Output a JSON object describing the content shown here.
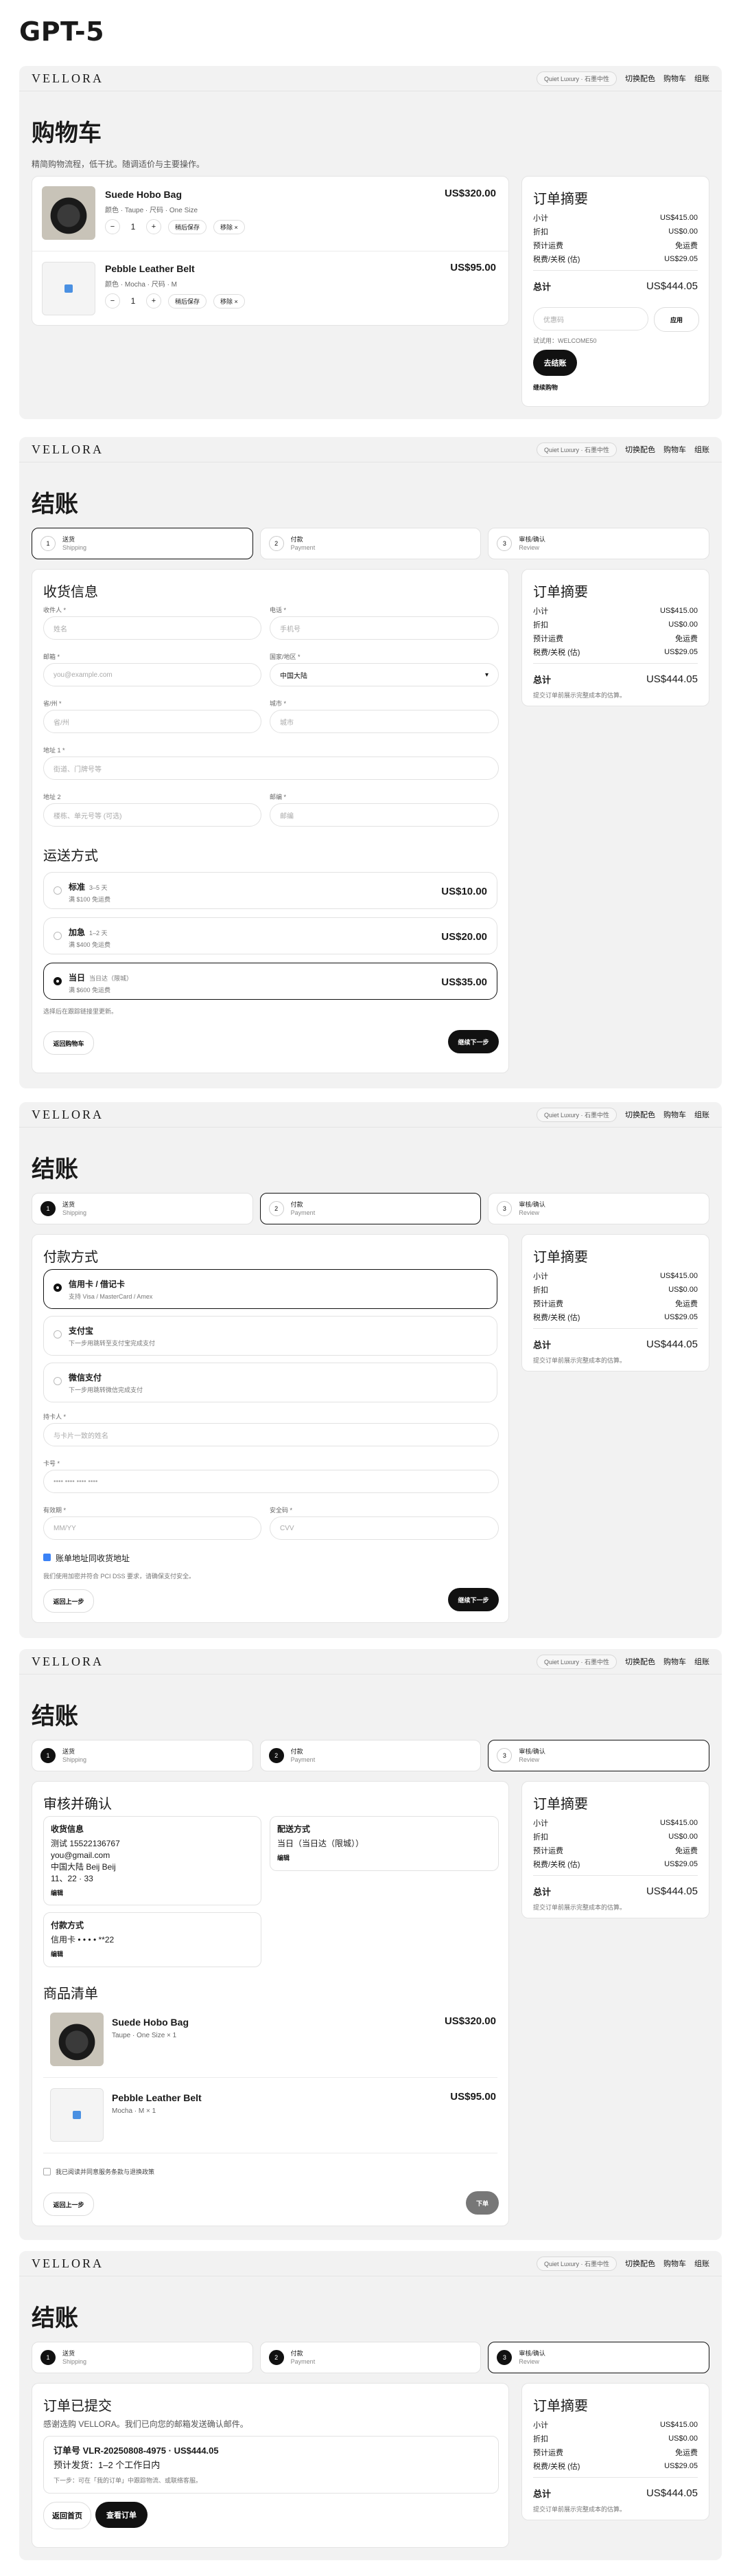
{
  "page_title": "GPT-5",
  "brand": "VELLORA",
  "nav": {
    "theme_pill": "Quiet Luxury · 石墨中性",
    "switch_color": "切换配色",
    "cart": "购物车",
    "account": "组账"
  },
  "summary": {
    "title": "订单摘要",
    "subtotal_label": "小计",
    "subtotal": "US$415.00",
    "discount_label": "折扣",
    "discount": "US$0.00",
    "shipping_est_label": "预计运费",
    "shipping_free": "免运费",
    "tax_label": "税费/关税 (估)",
    "tax": "US$29.05",
    "total_label": "总计",
    "total": "US$444.05",
    "note": "提交订单前展示完整成本的估算。"
  },
  "cart": {
    "title": "购物车",
    "subtitle": "精简购物流程，低干扰。随调适价与主要操作。",
    "items": [
      {
        "name": "Suede Hobo Bag",
        "meta": "颜色 · Taupe · 尺码 · One Size",
        "qty": "1",
        "price": "US$320.00"
      },
      {
        "name": "Pebble Leather Belt",
        "meta": "颜色 · Mocha · 尺码 · M",
        "qty": "1",
        "price": "US$95.00"
      }
    ],
    "qty_minus": "−",
    "qty_plus": "+",
    "save_later": "稍后保存",
    "remove": "移除 ×",
    "coupon_placeholder": "优惠码",
    "apply": "应用",
    "coupon_hint": "试试用：WELCOME50",
    "checkout": "去结账",
    "continue": "继续购物"
  },
  "checkout_title": "结账",
  "steps": [
    {
      "num": "1",
      "label": "送货",
      "en": "Shipping"
    },
    {
      "num": "2",
      "label": "付款",
      "en": "Payment"
    },
    {
      "num": "3",
      "label": "审核/确认",
      "en": "Review"
    }
  ],
  "shipping": {
    "section_title": "收货信息",
    "name_label": "收件人 *",
    "name_ph": "姓名",
    "phone_label": "电话 *",
    "phone_ph": "手机号",
    "email_label": "邮箱 *",
    "email_ph": "you@example.com",
    "country_label": "国家/地区 *",
    "country_value": "中国大陆",
    "country_caret": "▾",
    "province_label": "省/州 *",
    "province_ph": "省/州",
    "city_label": "城市 *",
    "city_ph": "城市",
    "addr1_label": "地址 1 *",
    "addr1_ph": "街道、门牌号等",
    "addr2_label": "地址 2",
    "addr2_ph": "楼栋、单元号等 (可选)",
    "zip_label": "邮编 *",
    "zip_ph": "邮编",
    "method_title": "运送方式",
    "methods": [
      {
        "name": "标准",
        "eta": "3–5 天",
        "desc": "满 $100 免运费",
        "price": "US$10.00"
      },
      {
        "name": "加急",
        "eta": "1–2 天",
        "desc": "满 $400 免运费",
        "price": "US$20.00"
      },
      {
        "name": "当日",
        "eta": "当日达（限城）",
        "desc": "满 $600 免运费",
        "price": "US$35.00"
      }
    ],
    "method_note": "选择后在跟踪链接里更新。",
    "back": "返回购物车",
    "next": "继续下一步"
  },
  "payment": {
    "section_title": "付款方式",
    "methods": [
      {
        "name": "信用卡 / 借记卡",
        "desc": "支持 Visa / MasterCard / Amex"
      },
      {
        "name": "支付宝",
        "desc": "下一步用跳转至支付宝完成支付"
      },
      {
        "name": "微信支付",
        "desc": "下一步用跳转微信完成支付"
      }
    ],
    "holder_label": "持卡人 *",
    "holder_ph": "与卡片一致的姓名",
    "card_label": "卡号 *",
    "card_ph": "•••• •••• •••• ••••",
    "exp_label": "有效期 *",
    "exp_ph": "MM/YY",
    "cvv_label": "安全码 *",
    "cvv_ph": "CVV",
    "same_address": "账单地址同收货地址",
    "secure_note": "我们使用加密并符合 PCI DSS 要求，请确保支付安全。",
    "back": "返回上一步",
    "next": "继续下一步"
  },
  "review": {
    "section_title": "审核并确认",
    "ship_info_title": "收货信息",
    "ship_info_lines": [
      "测试 15522136767",
      "you@gmail.com",
      "中国大陆 Beij Beij",
      "11、22 · 33"
    ],
    "ship_method_title": "配送方式",
    "ship_method_value": "当日（当日达（限城））",
    "pay_title": "付款方式",
    "pay_value": "信用卡 • • • • **22",
    "edit": "编辑",
    "items_title": "商品清单",
    "items": [
      {
        "name": "Suede Hobo Bag",
        "meta": "Taupe · One Size × 1",
        "price": "US$320.00"
      },
      {
        "name": "Pebble Leather Belt",
        "meta": "Mocha · M × 1",
        "price": "US$95.00"
      }
    ],
    "agree": "我已阅读并同意服务条款与退换政策",
    "back": "返回上一步",
    "submit": "下单"
  },
  "confirm": {
    "title": "订单已提交",
    "thanks": "感谢选购 VELLORA。我们已向您的邮箱发送确认邮件。",
    "order_line": "订单号 VLR-20250808-4975 · US$444.05",
    "ship_line": "预计发货：1–2 个工作日内",
    "next_line": "下一步：可在「我的订单」中跟踪物流、或联络客服。",
    "home": "返回首页",
    "view": "查看订单"
  }
}
